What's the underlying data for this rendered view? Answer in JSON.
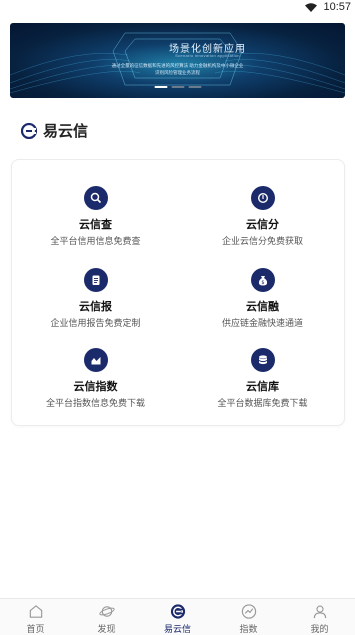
{
  "status_bar": {
    "time": "10:57"
  },
  "banner": {
    "title": "场景化创新应用",
    "subtitle": "Scenario innovation application",
    "line1": "通过全量的征信数据和先进的风控算法  助力金融机构及中小微企业",
    "line2": "识别风险管理业务流程"
  },
  "brand": {
    "name": "易云信"
  },
  "services": [
    {
      "title": "云信查",
      "desc": "全平台信用信息免费查",
      "icon": "search-icon"
    },
    {
      "title": "云信分",
      "desc": "企业云信分免费获取",
      "icon": "gauge-icon"
    },
    {
      "title": "云信报",
      "desc": "企业信用报告免费定制",
      "icon": "report-icon"
    },
    {
      "title": "云信融",
      "desc": "供应链金融快速通道",
      "icon": "money-bag-icon"
    },
    {
      "title": "云信指数",
      "desc": "全平台指数信息免费下载",
      "icon": "area-chart-icon"
    },
    {
      "title": "云信库",
      "desc": "全平台数据库免费下载",
      "icon": "database-icon"
    }
  ],
  "tabbar": {
    "items": [
      {
        "label": "首页",
        "icon": "home-icon"
      },
      {
        "label": "发现",
        "icon": "planet-icon"
      },
      {
        "label": "易云信",
        "icon": "brand-logo-icon"
      },
      {
        "label": "指数",
        "icon": "trend-icon"
      },
      {
        "label": "我的",
        "icon": "user-icon"
      }
    ],
    "active_index": 2
  },
  "colors": {
    "accent": "#1b2a6b",
    "banner_bg": "#0f3e6b"
  }
}
